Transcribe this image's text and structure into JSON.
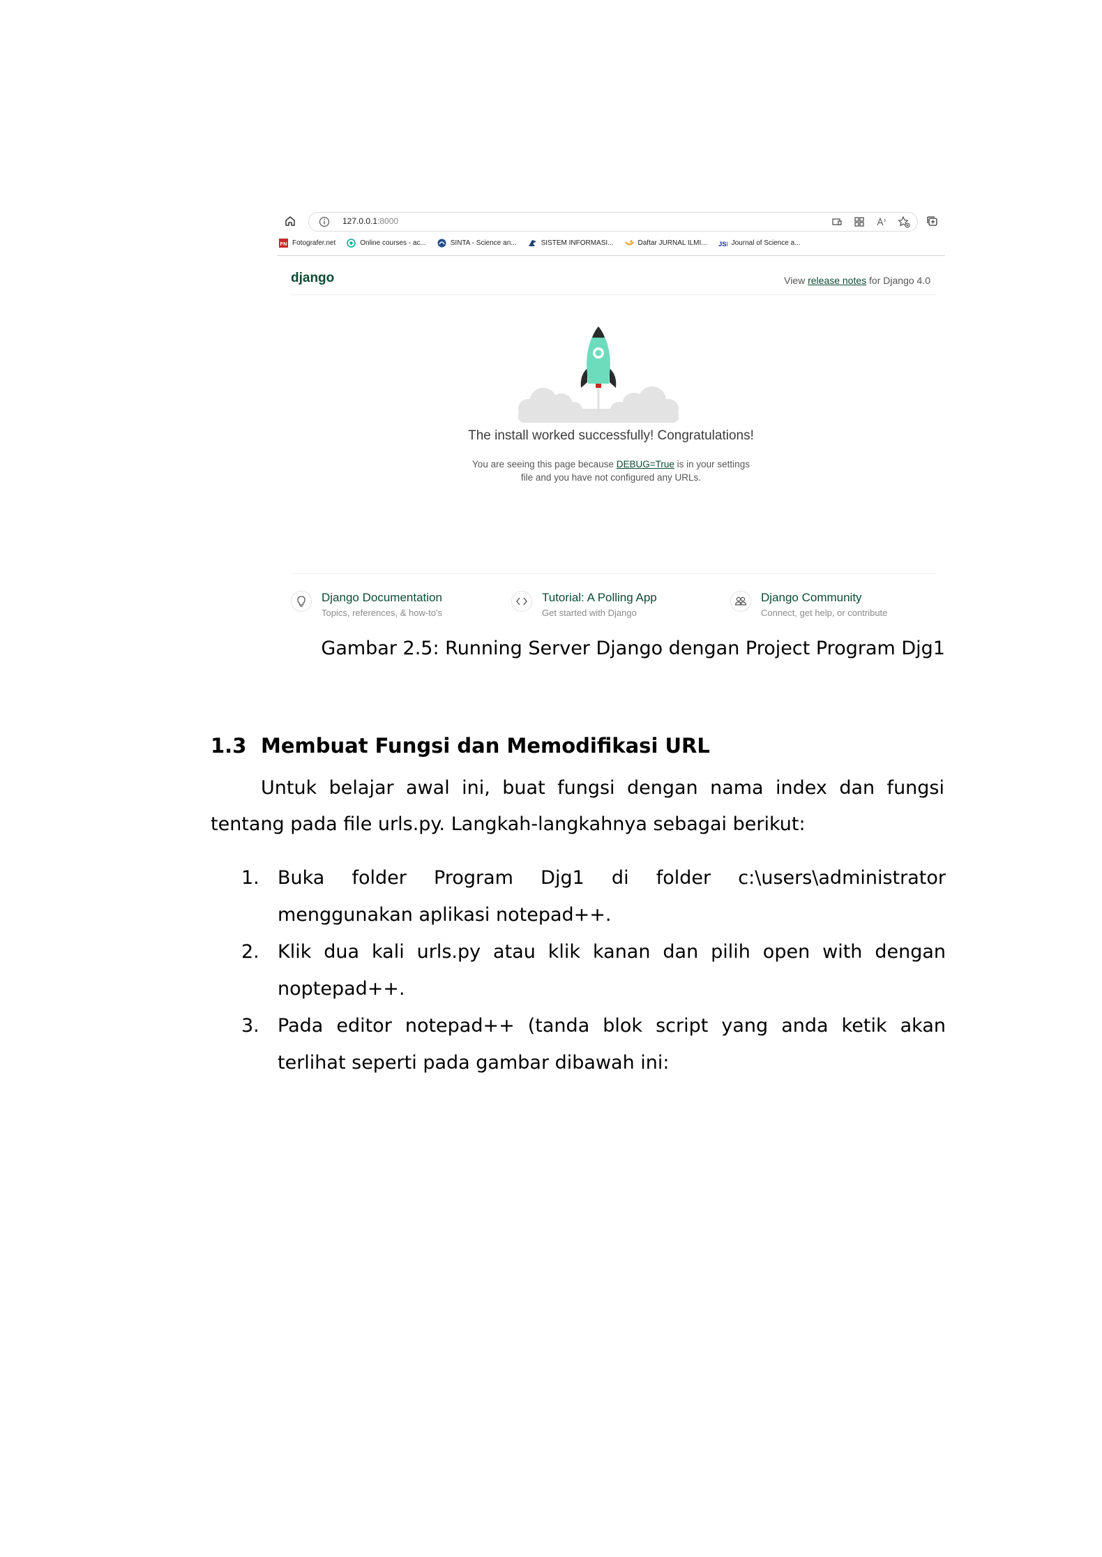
{
  "screenshot": {
    "browser": {
      "url_host": "127.0.0.1",
      "url_port": ":8000",
      "bookmarks": [
        {
          "label": "Fotografer.net",
          "icon": "fotografer-favicon",
          "color": "#c62828"
        },
        {
          "label": "Online courses - ac...",
          "icon": "online-courses-favicon",
          "color": "#12a89a"
        },
        {
          "label": "SINTA - Science an...",
          "icon": "sinta-favicon",
          "color": "#1e4f8a"
        },
        {
          "label": "SISTEM INFORMASI...",
          "icon": "sistem-informasi-favicon",
          "color": "#1d3f6f"
        },
        {
          "label": "Daftar JURNAL ILMI...",
          "icon": "daftar-jurnal-favicon",
          "color": "#f29b1d"
        },
        {
          "label": "Journal of Science a...",
          "icon": "journal-science-favicon",
          "color": "#1f2ab8"
        }
      ]
    },
    "django": {
      "logo": "django",
      "release_prefix": "View",
      "release_link": "release notes",
      "release_suffix": "for Django 4.0",
      "congrats": "The install worked successfully! Congratulations!",
      "debug_prefix": "You are seeing this page because",
      "debug_link": "DEBUG=True",
      "debug_suffix": "is in your settings file and you have not configured any URLs.",
      "cards": [
        {
          "title": "Django Documentation",
          "subtitle": "Topics, references, & how-to's",
          "icon": "lightbulb-icon"
        },
        {
          "title": "Tutorial: A Polling App",
          "subtitle": "Get started with Django",
          "icon": "code-icon"
        },
        {
          "title": "Django Community",
          "subtitle": "Connect, get help, or contribute",
          "icon": "people-icon"
        }
      ],
      "accent_color": "#0c4b33",
      "rocket_color": "#6ddcbd"
    }
  },
  "document": {
    "caption": "Gambar 2.5: Running Server Django dengan Project Program Djg1",
    "section_number": "1.3",
    "section_title": "Membuat Fungsi dan Memodifikasi URL",
    "paragraph": "Untuk belajar awal ini, buat fungsi dengan nama index dan fungsi tentang pada file urls.py. Langkah-langkahnya sebagai berikut:",
    "steps": [
      {
        "num": "1.",
        "text": "Buka folder Program Djg1 di folder c:\\users\\administrator menggunakan aplikasi notepad++."
      },
      {
        "num": "2.",
        "text": "Klik dua kali urls.py atau klik kanan dan pilih open with dengan noptepad++."
      },
      {
        "num": "3.",
        "text": "Pada editor notepad++ (tanda blok script yang anda ketik akan terlihat seperti pada gambar dibawah ini:"
      }
    ]
  }
}
